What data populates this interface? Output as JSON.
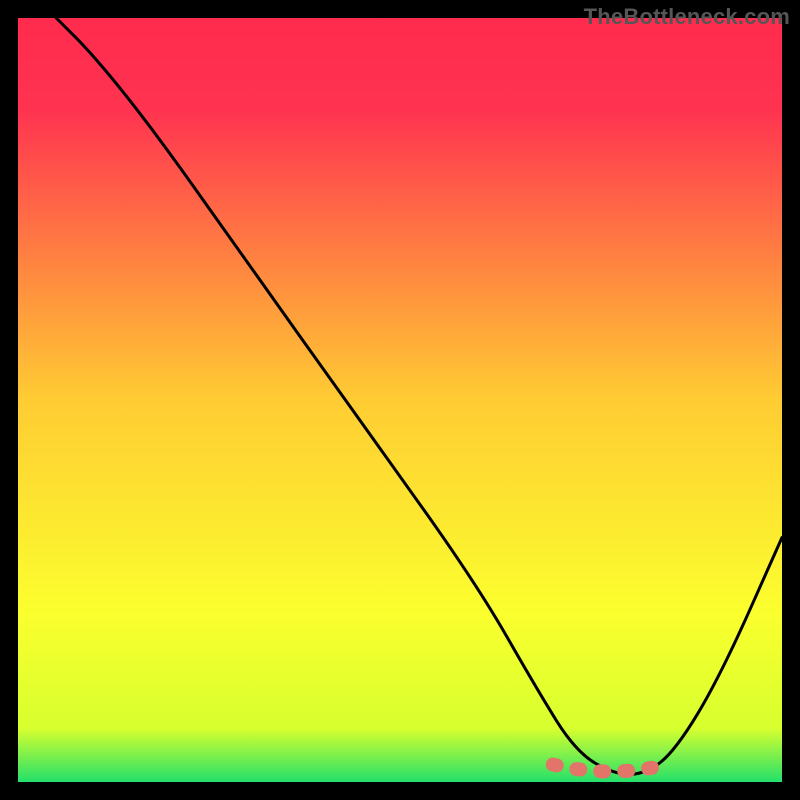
{
  "watermark": "TheBottleneck.com",
  "colors": {
    "gradient_stops": [
      {
        "offset": "0%",
        "color": "#ff2b4e"
      },
      {
        "offset": "12%",
        "color": "#ff3350"
      },
      {
        "offset": "50%",
        "color": "#ffcc33"
      },
      {
        "offset": "78%",
        "color": "#fbff2e"
      },
      {
        "offset": "93%",
        "color": "#d7ff2e"
      },
      {
        "offset": "100%",
        "color": "#23e06a"
      }
    ],
    "curve": "#000000",
    "optimal_band": "#e2746a"
  },
  "chart_data": {
    "type": "line",
    "title": "",
    "xlabel": "",
    "ylabel": "",
    "xlim": [
      0,
      100
    ],
    "ylim": [
      0,
      100
    ],
    "grid": false,
    "legend": false,
    "series": [
      {
        "name": "bottleneck-curve",
        "x": [
          5,
          10,
          18,
          30,
          45,
          60,
          68,
          73,
          78,
          82,
          86,
          92,
          100
        ],
        "y": [
          100,
          95,
          85,
          68,
          47,
          26,
          12,
          4,
          1,
          1,
          4,
          14,
          32
        ]
      }
    ],
    "optimal_range": {
      "x_start": 70,
      "x_end": 85,
      "y": 1.5
    }
  }
}
